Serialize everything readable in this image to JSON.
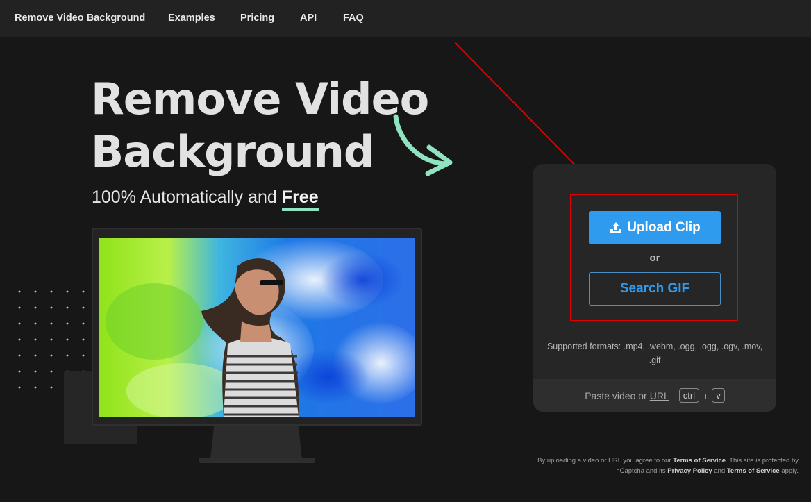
{
  "nav": {
    "items": [
      {
        "label": "Remove Video Background"
      },
      {
        "label": "Examples"
      },
      {
        "label": "Pricing"
      },
      {
        "label": "API"
      },
      {
        "label": "FAQ"
      }
    ]
  },
  "hero": {
    "title": "Remove Video Background",
    "subtitle_prefix": "100% Automatically and",
    "subtitle_emphasis": "Free"
  },
  "upload": {
    "upload_label": "Upload Clip",
    "or_label": "or",
    "search_label": "Search GIF",
    "formats": "Supported formats: .mp4, .webm, .ogg, .ogg, .ogv, .mov, .gif",
    "paste_prefix": "Paste video or",
    "paste_url": "URL",
    "key_ctrl": "ctrl",
    "key_plus": "+",
    "key_v": "v"
  },
  "legal": {
    "p1": "By uploading a video or URL you agree to our",
    "tos": "Terms of Service",
    "p2": ". This site is protected by hCaptcha and its",
    "privacy": "Privacy Policy",
    "p3": "and",
    "tos2": "Terms of Service",
    "p4": "apply."
  },
  "colors": {
    "accent_blue": "#2f9bee",
    "accent_mint": "#8fe3c1",
    "annotation_red": "#e00000"
  }
}
